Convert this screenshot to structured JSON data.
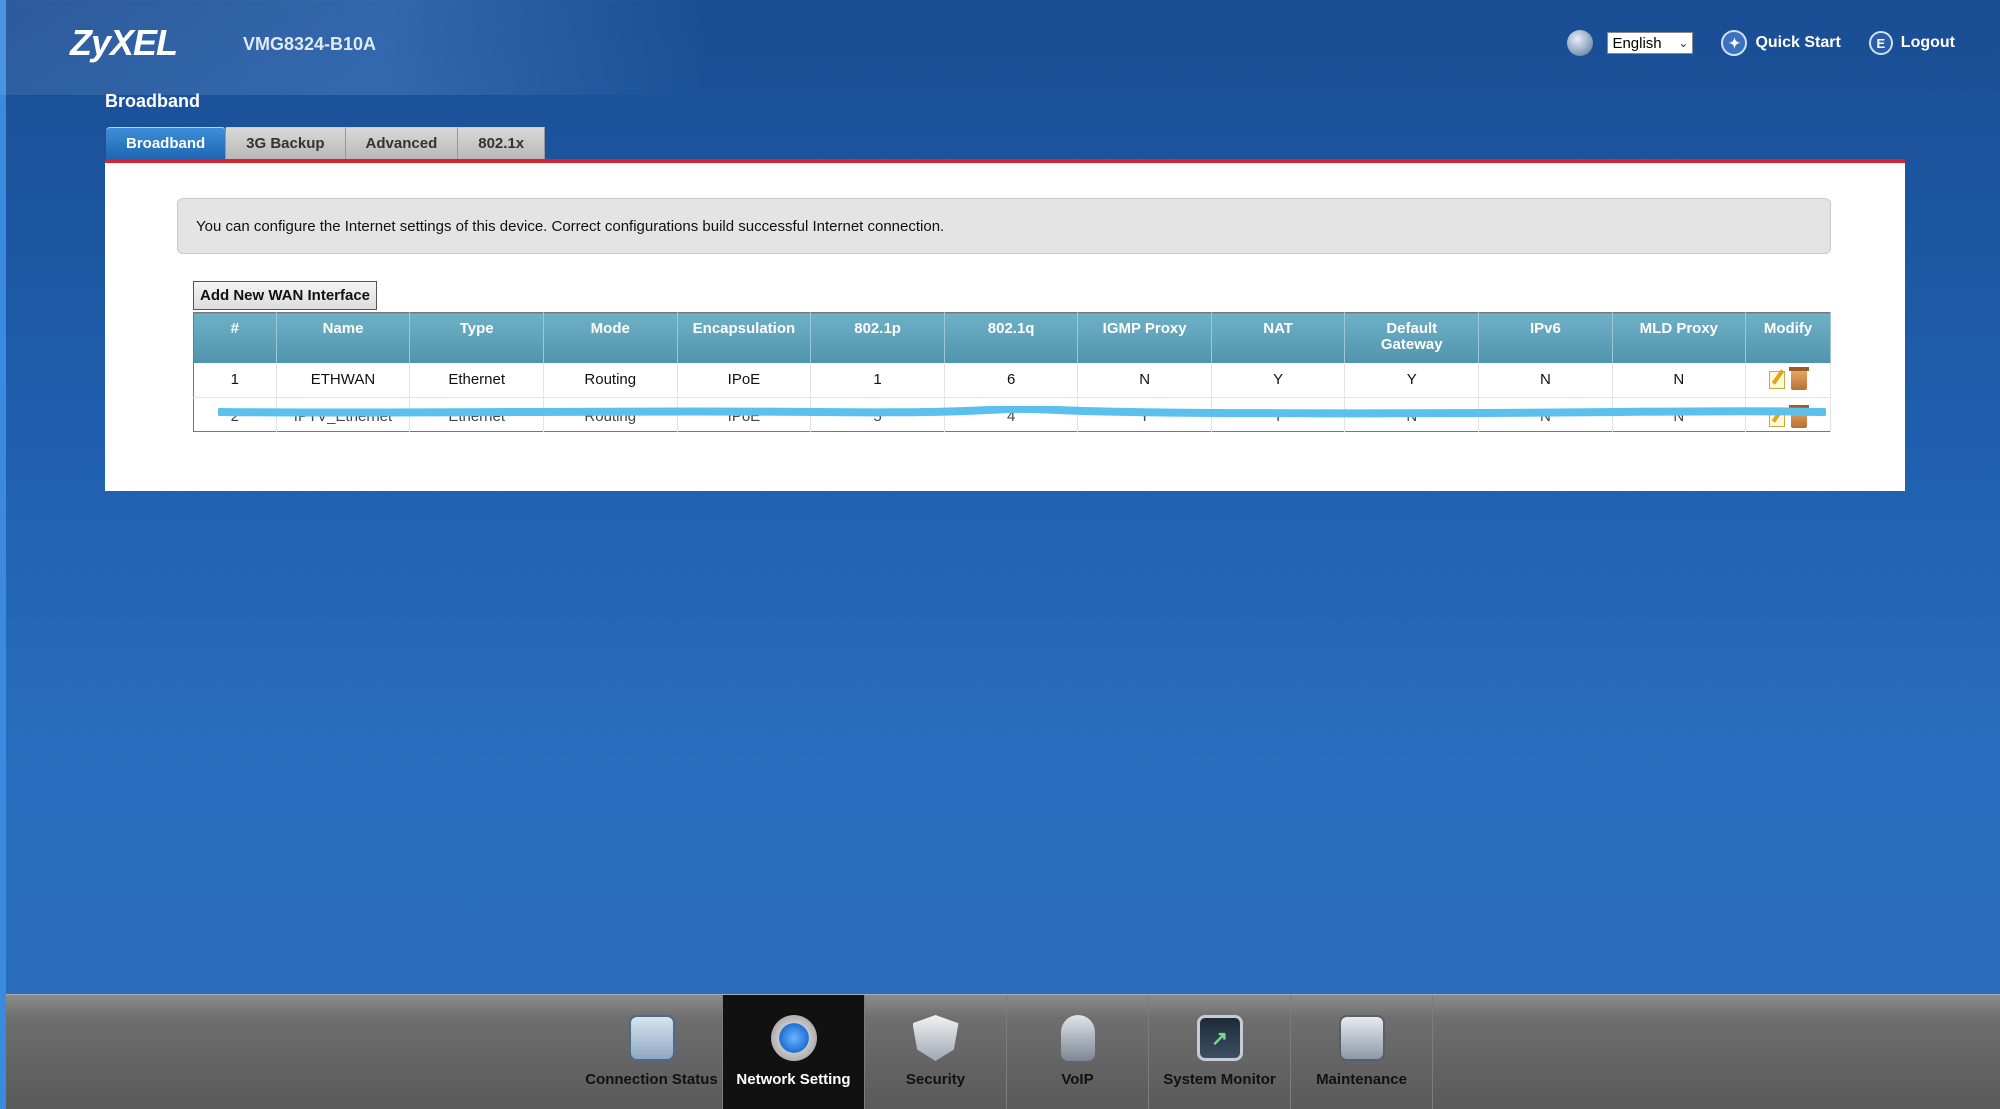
{
  "header": {
    "logo": "ZyXEL",
    "model": "VMG8324-B10A",
    "language": "English",
    "quick_start": "Quick Start",
    "logout": "Logout"
  },
  "page": {
    "title": "Broadband",
    "tabs": [
      "Broadband",
      "3G Backup",
      "Advanced",
      "802.1x"
    ],
    "active_tab": "Broadband",
    "notice": "You can configure the Internet settings of this device. Correct configurations build successful Internet connection.",
    "add_button": "Add New WAN Interface"
  },
  "table": {
    "headers": [
      "#",
      "Name",
      "Type",
      "Mode",
      "Encapsulation",
      "802.1p",
      "802.1q",
      "IGMP Proxy",
      "NAT",
      "Default Gateway",
      "IPv6",
      "MLD Proxy",
      "Modify"
    ],
    "rows": [
      [
        "1",
        "ETHWAN",
        "Ethernet",
        "Routing",
        "IPoE",
        "1",
        "6",
        "N",
        "Y",
        "Y",
        "N",
        "N"
      ],
      [
        "2",
        "IPTV_Ethernet",
        "Ethernet",
        "Routing",
        "IPoE",
        "5",
        "4",
        "Y",
        "Y",
        "N",
        "N",
        "N"
      ]
    ]
  },
  "bottom_nav": {
    "items": [
      "Connection Status",
      "Network Setting",
      "Security",
      "VoIP",
      "System Monitor",
      "Maintenance"
    ],
    "active": "Network Setting"
  },
  "colors": {
    "accent_red": "#d4262e",
    "table_header": "#5aa0b8",
    "active_tab": "#2a78c6",
    "scribble": "#5bc0ec"
  }
}
